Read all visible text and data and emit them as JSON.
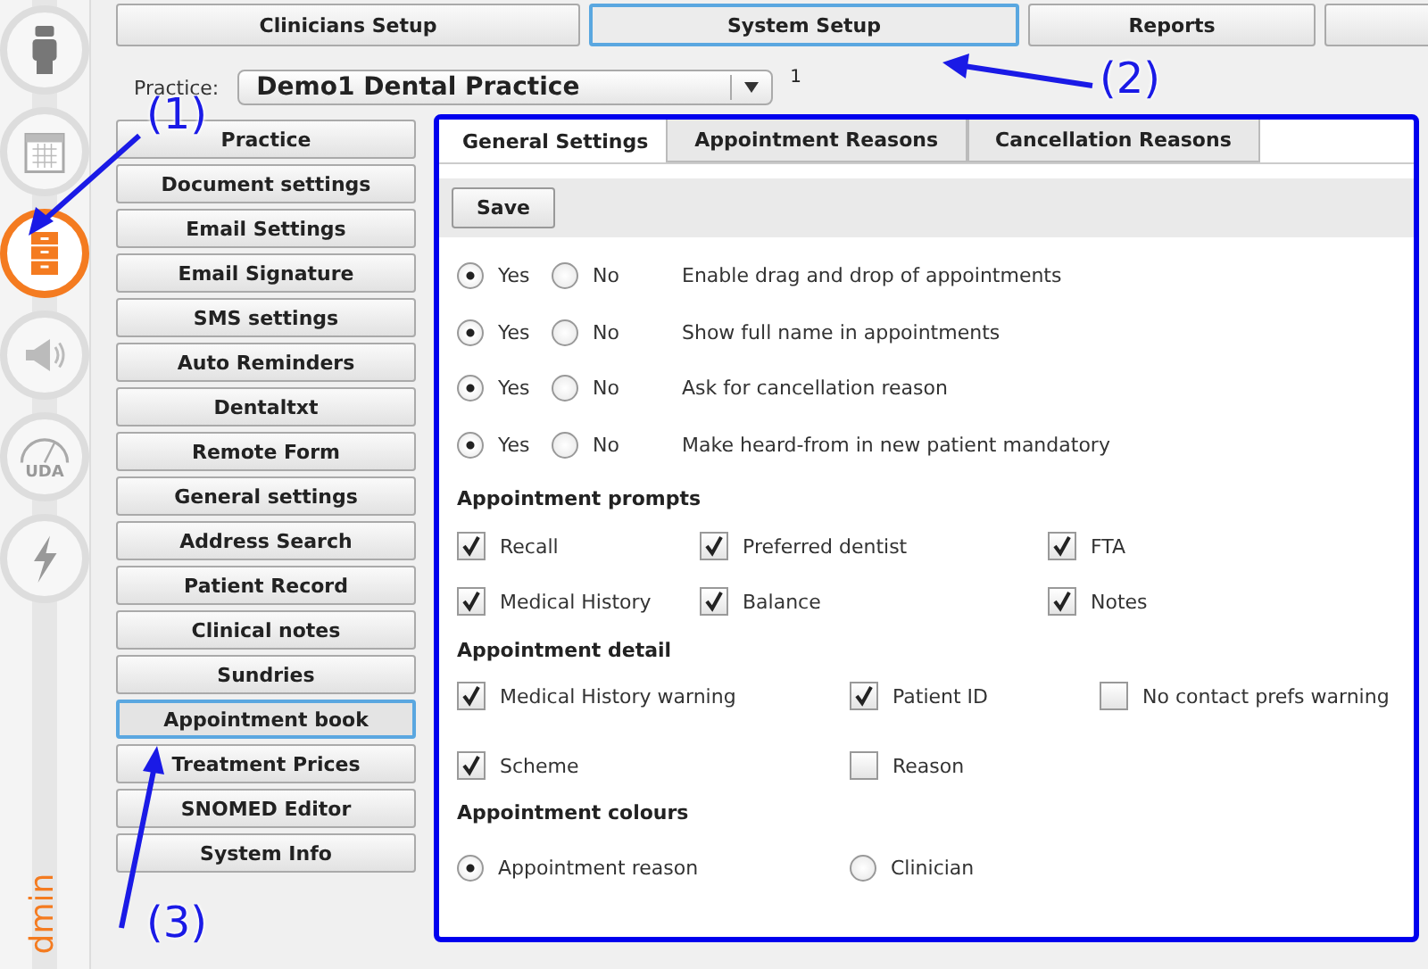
{
  "nav_rail": {
    "items": [
      {
        "kind": "person",
        "selected": false
      },
      {
        "kind": "calendar",
        "selected": false
      },
      {
        "kind": "cabinet",
        "selected": true
      },
      {
        "kind": "megaphone",
        "selected": false
      },
      {
        "kind": "gauge",
        "selected": false,
        "label": "UDA"
      },
      {
        "kind": "lightning",
        "selected": false
      }
    ],
    "caption": "dmin"
  },
  "top_tabs": [
    {
      "label": "Clinicians Setup",
      "selected": false
    },
    {
      "label": "System Setup",
      "selected": true
    },
    {
      "label": "Reports",
      "selected": false
    },
    {
      "selected": false
    }
  ],
  "practice": {
    "label": "Practice:",
    "value": "Demo1 Dental Practice",
    "number": "1"
  },
  "menu": [
    {
      "label": "Practice",
      "selected": false
    },
    {
      "label": "Document settings",
      "selected": false
    },
    {
      "label": "Email Settings",
      "selected": false
    },
    {
      "label": "Email Signature",
      "selected": false
    },
    {
      "label": "SMS settings",
      "selected": false
    },
    {
      "label": "Auto Reminders",
      "selected": false
    },
    {
      "label": "Dentaltxt",
      "selected": false
    },
    {
      "label": "Remote Form",
      "selected": false
    },
    {
      "label": "General settings",
      "selected": false
    },
    {
      "label": "Address Search",
      "selected": false
    },
    {
      "label": "Patient Record",
      "selected": false
    },
    {
      "label": "Clinical notes",
      "selected": false
    },
    {
      "label": "Sundries",
      "selected": false
    },
    {
      "label": "Appointment book",
      "selected": true
    },
    {
      "label": "Treatment Prices",
      "selected": false
    },
    {
      "label": "SNOMED Editor",
      "selected": false
    },
    {
      "label": "System Info",
      "selected": false
    }
  ],
  "panel_tabs": [
    {
      "label": "General Settings",
      "selected": true
    },
    {
      "label": "Appointment Reasons",
      "selected": false
    },
    {
      "label": "Cancellation Reasons",
      "selected": false
    }
  ],
  "save_button": "Save",
  "yes_no_settings": [
    {
      "options": [
        {
          "label": "Yes",
          "selected": true
        },
        {
          "label": "No",
          "selected": false
        }
      ],
      "label": "Enable drag and drop of appointments"
    },
    {
      "options": [
        {
          "label": "Yes",
          "selected": true
        },
        {
          "label": "No",
          "selected": false
        }
      ],
      "label": "Show full name in appointments"
    },
    {
      "options": [
        {
          "label": "Yes",
          "selected": true
        },
        {
          "label": "No",
          "selected": false
        }
      ],
      "label": "Ask for cancellation reason"
    },
    {
      "options": [
        {
          "label": "Yes",
          "selected": true
        },
        {
          "label": "No",
          "selected": false
        }
      ],
      "label": "Make heard-from in new patient mandatory"
    }
  ],
  "appointment_prompts": {
    "heading": "Appointment prompts",
    "options": [
      {
        "label": "Recall",
        "checked": true
      },
      {
        "label": "Preferred dentist",
        "checked": true
      },
      {
        "label": "FTA",
        "checked": true
      },
      {
        "label": "Medical History",
        "checked": true
      },
      {
        "label": "Balance",
        "checked": true
      },
      {
        "label": "Notes",
        "checked": true
      }
    ]
  },
  "appointment_detail": {
    "heading": "Appointment detail",
    "options": [
      {
        "label": "Medical History warning",
        "checked": true
      },
      {
        "label": "Patient ID",
        "checked": true
      },
      {
        "label": "No contact prefs warning",
        "checked": false
      },
      {
        "label": "Scheme",
        "checked": true
      },
      {
        "label": "Reason",
        "checked": false
      }
    ]
  },
  "appointment_colours": {
    "heading": "Appointment colours",
    "options": [
      {
        "label": "Appointment reason",
        "selected": true
      },
      {
        "label": "Clinician",
        "selected": false
      }
    ]
  },
  "annotations": [
    {
      "label": "(1)"
    },
    {
      "label": "(2)"
    },
    {
      "label": "(3)"
    }
  ]
}
